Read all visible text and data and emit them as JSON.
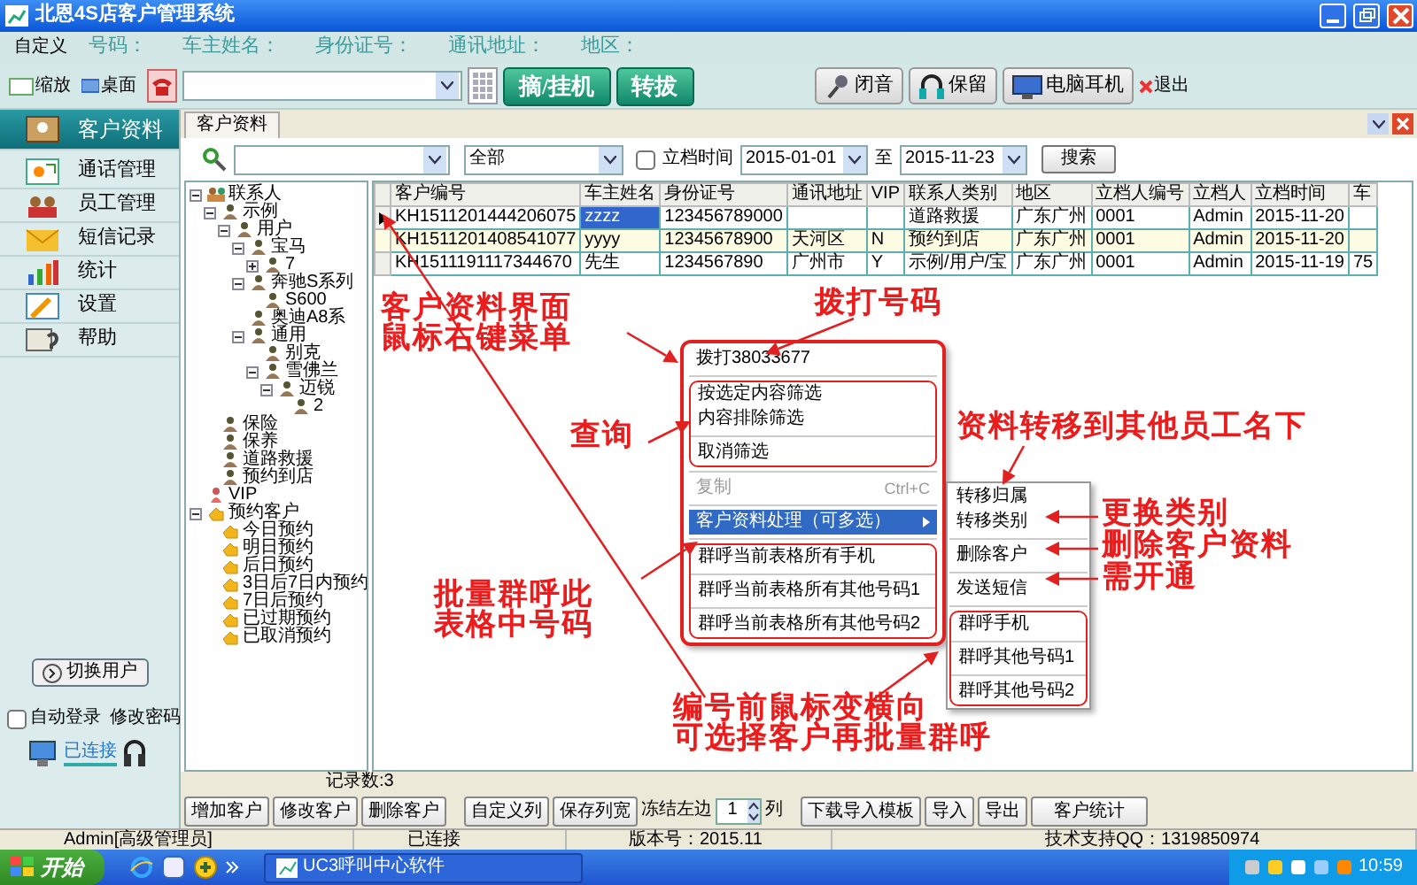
{
  "window": {
    "title": "北恩4S店客户管理系统"
  },
  "info_bar": {
    "customize": "自定义",
    "fields": [
      "号码：",
      "车主姓名：",
      "身份证号：",
      "通讯地址：",
      "地区："
    ]
  },
  "toolbar": {
    "zoom": "缩放",
    "desktop": "桌面",
    "dial_buttons": [
      "摘/挂机",
      "转拔"
    ],
    "call_buttons": [
      "闭音",
      "保留",
      "电脑耳机"
    ],
    "exit": "退出"
  },
  "sidebar": {
    "items": [
      {
        "label": "客户资料",
        "selected": true
      },
      {
        "label": "通话管理",
        "selected": false
      },
      {
        "label": "员工管理",
        "selected": false
      },
      {
        "label": "短信记录",
        "selected": false
      },
      {
        "label": "统计",
        "selected": false
      },
      {
        "label": "设置",
        "selected": false
      },
      {
        "label": "帮助",
        "selected": false
      }
    ],
    "switch_user": "切换用户",
    "auto_login": {
      "label": "自动登录",
      "checked": false
    },
    "change_password": "修改密码",
    "connection": "已连接"
  },
  "tab": {
    "label": "客户资料"
  },
  "search": {
    "type_filter": "全部",
    "date_filter": {
      "label": "立档时间",
      "checked": false
    },
    "from": "2015-01-01",
    "to_label": "至",
    "to": "2015-11-23",
    "button": "搜索"
  },
  "tree": [
    {
      "label": "联系人",
      "kind": "group",
      "expanded": true,
      "children": [
        {
          "label": "示例",
          "kind": "person",
          "expanded": true,
          "children": [
            {
              "label": "用户",
              "kind": "person",
              "expanded": true,
              "children": [
                {
                  "label": "宝马",
                  "kind": "person",
                  "expanded": true,
                  "children": [
                    {
                      "label": "7",
                      "kind": "person",
                      "expanded": false
                    }
                  ]
                },
                {
                  "label": "奔驰S系列",
                  "kind": "person",
                  "expanded": true,
                  "children": [
                    {
                      "label": "S600",
                      "kind": "person"
                    }
                  ]
                },
                {
                  "label": "奥迪A8系",
                  "kind": "person"
                },
                {
                  "label": "通用",
                  "kind": "person",
                  "expanded": true,
                  "children": [
                    {
                      "label": "别克",
                      "kind": "person"
                    },
                    {
                      "label": "雪佛兰",
                      "kind": "person",
                      "expanded": true,
                      "children": [
                        {
                          "label": "迈锐",
                          "kind": "person",
                          "expanded": true,
                          "children": [
                            {
                              "label": "2",
                              "kind": "person"
                            }
                          ]
                        }
                      ]
                    }
                  ]
                }
              ]
            }
          ]
        },
        {
          "label": "保险",
          "kind": "person"
        },
        {
          "label": "保养",
          "kind": "person"
        },
        {
          "label": "道路救援",
          "kind": "person"
        },
        {
          "label": "预约到店",
          "kind": "person"
        }
      ]
    },
    {
      "label": "VIP",
      "kind": "vip"
    },
    {
      "label": "预约客户",
      "kind": "hand",
      "expanded": true,
      "children": [
        {
          "label": "今日预约",
          "kind": "hand"
        },
        {
          "label": "明日预约",
          "kind": "hand"
        },
        {
          "label": "后日预约",
          "kind": "hand"
        },
        {
          "label": "3日后7日内预约",
          "kind": "hand"
        },
        {
          "label": "7日后预约",
          "kind": "hand"
        },
        {
          "label": "已过期预约",
          "kind": "hand"
        },
        {
          "label": "已取消预约",
          "kind": "hand"
        }
      ]
    }
  ],
  "table": {
    "columns": [
      "客户编号",
      "车主姓名",
      "身份证号",
      "通讯地址",
      "VIP",
      "联系人类别",
      "地区",
      "立档人编号",
      "立档人",
      "立档时间",
      "车"
    ],
    "rows": [
      {
        "current": true,
        "cells": [
          {
            "text": "KH1511201444206075",
            "selected": false
          },
          {
            "text": "zzzz",
            "selected": true
          },
          {
            "text": "123456789000",
            "selected": false
          },
          {
            "text": null,
            "selected": false
          },
          {
            "text": null,
            "selected": false
          },
          {
            "text": "道路救援",
            "selected": false
          },
          {
            "text": "广东广州",
            "selected": false
          },
          {
            "text": "0001",
            "selected": false
          },
          {
            "text": "Admin",
            "selected": false
          },
          {
            "text": "2015-11-20",
            "selected": false
          },
          {
            "text": null,
            "selected": false
          }
        ]
      },
      {
        "current": false,
        "cells": [
          {
            "text": "KH1511201408541077",
            "selected": false
          },
          {
            "text": "yyyy",
            "selected": false
          },
          {
            "text": "12345678900",
            "selected": false
          },
          {
            "text": "天河区",
            "selected": false
          },
          {
            "text": "N",
            "selected": false
          },
          {
            "text": "预约到店",
            "selected": false
          },
          {
            "text": "广东广州",
            "selected": false
          },
          {
            "text": "0001",
            "selected": false
          },
          {
            "text": "Admin",
            "selected": false
          },
          {
            "text": "2015-11-20",
            "selected": false
          },
          {
            "text": null,
            "selected": false
          }
        ]
      },
      {
        "current": false,
        "cells": [
          {
            "text": "KH1511191117344670",
            "selected": false
          },
          {
            "text": "先生",
            "selected": false
          },
          {
            "text": "1234567890",
            "selected": false
          },
          {
            "text": "广州市",
            "selected": false
          },
          {
            "text": "Y",
            "selected": false
          },
          {
            "text": "示例/用户/宝",
            "selected": false
          },
          {
            "text": "广东广州",
            "selected": false
          },
          {
            "text": "0001",
            "selected": false
          },
          {
            "text": "Admin",
            "selected": false
          },
          {
            "text": "2015-11-19",
            "selected": false
          },
          {
            "text": "75",
            "selected": false
          }
        ]
      }
    ]
  },
  "context_menu": {
    "groups": [
      {
        "framed": false,
        "items": [
          {
            "label": "拨打38033677",
            "disabled": false,
            "selected": false
          }
        ]
      },
      {
        "framed": true,
        "items": [
          {
            "label": "按选定内容筛选",
            "disabled": false,
            "selected": false
          },
          {
            "label": "内容排除筛选",
            "disabled": false,
            "selected": false
          },
          {
            "kind": "separator"
          },
          {
            "label": "取消筛选",
            "disabled": false,
            "selected": false
          }
        ]
      },
      {
        "framed": false,
        "items": [
          {
            "label": "复制",
            "shortcut": "Ctrl+C",
            "disabled": true,
            "selected": false
          }
        ]
      },
      {
        "framed": false,
        "items": [
          {
            "label": "客户资料处理（可多选）",
            "disabled": false,
            "selected": true,
            "submenu": true
          }
        ]
      },
      {
        "framed": true,
        "items": [
          {
            "label": "群呼当前表格所有手机",
            "disabled": false,
            "selected": false
          },
          {
            "kind": "separator"
          },
          {
            "label": "群呼当前表格所有其他号码1",
            "disabled": false,
            "selected": false
          },
          {
            "kind": "separator"
          },
          {
            "label": "群呼当前表格所有其他号码2",
            "disabled": false,
            "selected": false
          }
        ]
      }
    ]
  },
  "submenu": {
    "groups": [
      {
        "framed": false,
        "items": [
          {
            "label": "转移归属",
            "disabled": false,
            "selected": false
          },
          {
            "label": "转移类别",
            "disabled": false,
            "selected": false
          }
        ]
      },
      {
        "framed": false,
        "items": [
          {
            "label": "删除客户",
            "disabled": false,
            "selected": false
          }
        ]
      },
      {
        "framed": false,
        "items": [
          {
            "label": "发送短信",
            "disabled": false,
            "selected": false
          }
        ]
      },
      {
        "framed": true,
        "items": [
          {
            "label": "群呼手机",
            "disabled": false,
            "selected": false
          },
          {
            "kind": "separator"
          },
          {
            "label": "群呼其他号码1",
            "disabled": false,
            "selected": false
          },
          {
            "kind": "separator"
          },
          {
            "label": "群呼其他号码2",
            "disabled": false,
            "selected": false
          }
        ]
      }
    ]
  },
  "annotations": [
    {
      "lines": [
        "客户资料界面",
        "鼠标右键菜单"
      ]
    },
    {
      "lines": [
        "拨打号码"
      ]
    },
    {
      "lines": [
        "查询"
      ]
    },
    {
      "lines": [
        "资料转移到其他员工名下"
      ]
    },
    {
      "lines": [
        "更换类别"
      ]
    },
    {
      "lines": [
        "删除客户资料"
      ]
    },
    {
      "lines": [
        "需开通"
      ]
    },
    {
      "lines": [
        "批量群呼此",
        "表格中号码"
      ]
    },
    {
      "lines": [
        "编号前鼠标变横向",
        "可选择客户再批量群呼"
      ]
    }
  ],
  "record_count": "记录数:3",
  "bottom_toolbar": [
    {
      "kind": "button",
      "label": "增加客户"
    },
    {
      "kind": "button",
      "label": "修改客户"
    },
    {
      "kind": "button",
      "label": "删除客户"
    },
    {
      "kind": "button",
      "label": "自定义列"
    },
    {
      "kind": "button",
      "label": "保存列宽"
    },
    {
      "kind": "spinner",
      "label": "冻结左边",
      "value": "1",
      "unit": "列"
    },
    {
      "kind": "button",
      "label": "下载导入模板"
    },
    {
      "kind": "button",
      "label": "导入"
    },
    {
      "kind": "button",
      "label": "导出"
    },
    {
      "kind": "button",
      "label": "客户统计"
    }
  ],
  "status_bar": [
    "Admin[高级管理员]",
    "已连接",
    "版本号：2015.11",
    "技术支持QQ：1319850974"
  ],
  "taskbar": {
    "start": "开始",
    "task": "UC3呼叫中心软件",
    "clock": "10:59"
  }
}
